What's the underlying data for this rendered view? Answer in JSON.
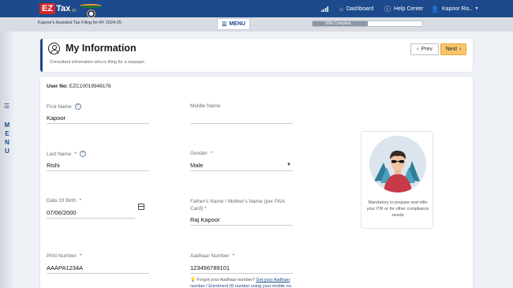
{
  "brand": {
    "logo_ez": "EZ",
    "logo_tax": "Tax",
    "logo_in": ".in"
  },
  "topnav": {
    "dashboard": "Dashboard",
    "help_center": "Help Center",
    "user": "Kapoor Ris..",
    "dashboard_icon": "home-icon",
    "help_icon": "help-icon",
    "user_icon": "user-icon",
    "signal_icon": "signal-bars-icon"
  },
  "subbar": {
    "subtitle": "Kapoor's Assisted Tax Filing for AY 2024-25",
    "menu_label": "MENU",
    "progress_label": "50% Complete",
    "progress_percent": 50
  },
  "sidemenu": {
    "label": "MENU"
  },
  "header": {
    "title": "My Information",
    "description": "Consultant information who is filing for a taxpayer.",
    "prev_label": "Prev",
    "next_label": "Next"
  },
  "form": {
    "user_no_label": "User No:",
    "user_no_value": "EZC10019949178",
    "first_name": {
      "label": "First Name",
      "value": "Kapoor"
    },
    "middle_name": {
      "label": "Middle Name",
      "value": ""
    },
    "last_name": {
      "label": "Last Name",
      "required": "*",
      "value": "Rishi"
    },
    "gender": {
      "label": "Gender",
      "required": "*",
      "value": "Male"
    },
    "dob": {
      "label": "Date Of Birth",
      "required": "*",
      "value": "07/06/2000"
    },
    "parent_name": {
      "label": "Father's Name / Mother's Name (per PAN Card)",
      "required": "*",
      "value": "Raj Kapoor"
    },
    "pan": {
      "label": "PAN Number",
      "required": "*",
      "value": "AAAPA1234A"
    },
    "aadhaar": {
      "label": "Aadhaar Number",
      "required": "*",
      "value": "123456789101"
    },
    "aadhaar_note_prefix": "Forgot your Aadhaar number?",
    "aadhaar_note_link": "Get your Aadhaar number / Enrolment ID number using your mobile no."
  },
  "promo": {
    "text": "Mandatory to prepare and efile your ITR or for other compliance needs"
  },
  "colors": {
    "brand_blue": "#1c4a8c",
    "next_button": "#f9c66b",
    "required": "#d32f2f"
  }
}
